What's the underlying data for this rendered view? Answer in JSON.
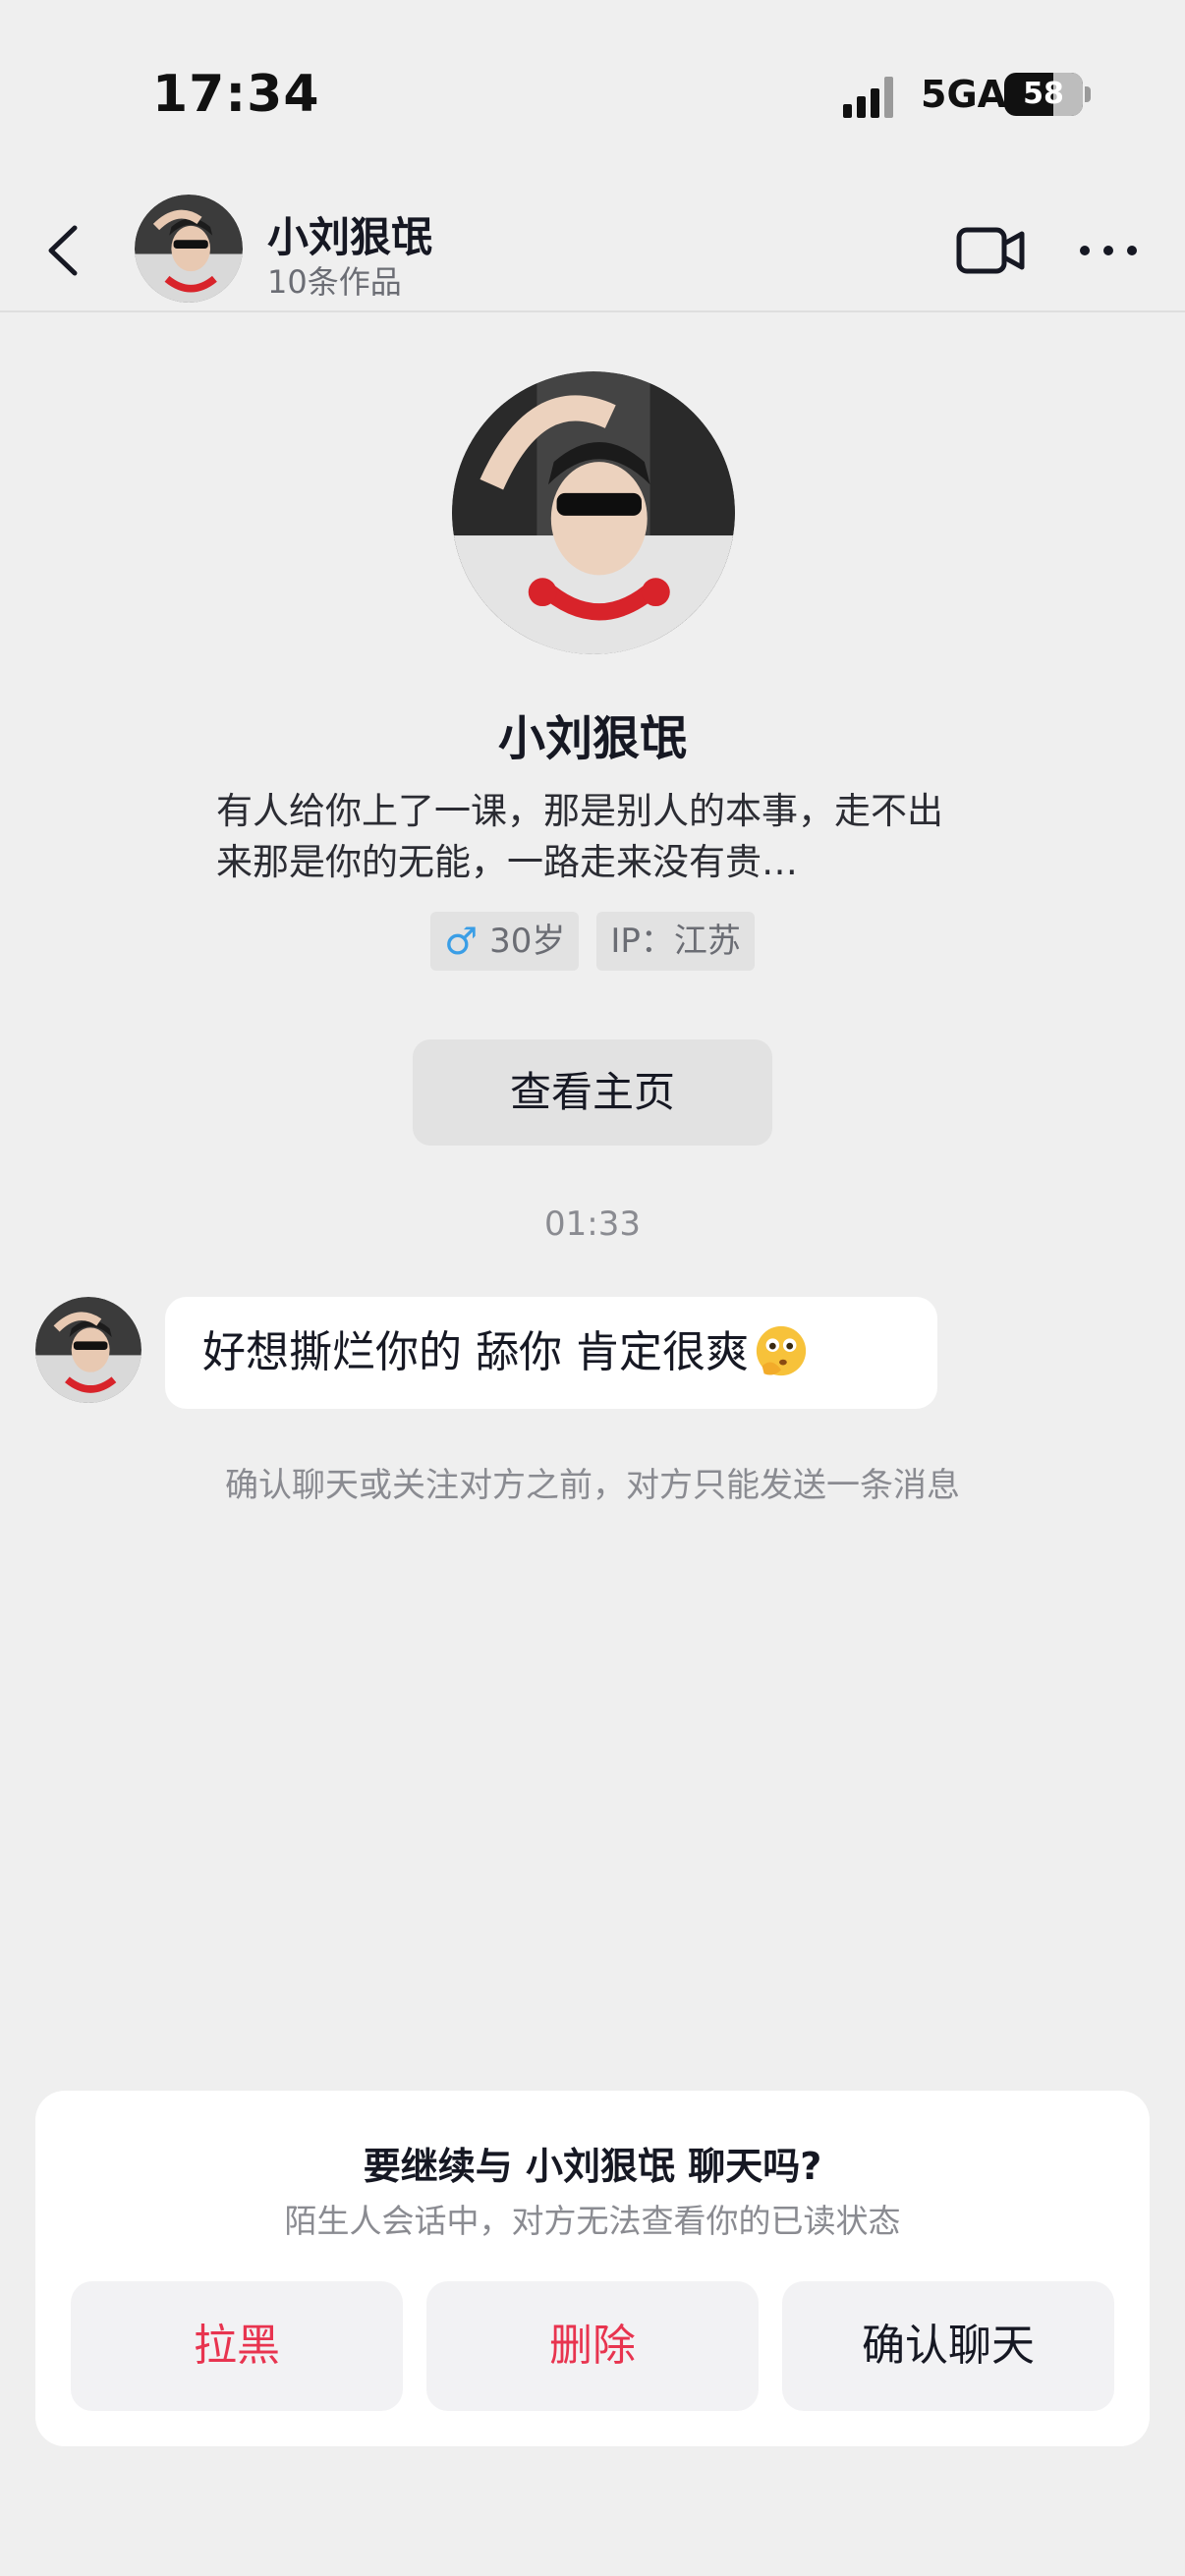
{
  "status_bar": {
    "time": "17:34",
    "network": "5GA",
    "battery": "58"
  },
  "header": {
    "name": "小刘狠氓",
    "subtitle": "10条作品",
    "icons": [
      "back-icon",
      "avatar",
      "video-call-icon",
      "more-icon"
    ]
  },
  "profile": {
    "name": "小刘狠氓",
    "bio": "有人给你上了一课，那是别人的本事，走不出来那是你的无能，一路走来没有贵…",
    "tags": {
      "gender_icon": "♂",
      "age": "30岁",
      "ip": "IP：江苏"
    },
    "home_button": "查看主页"
  },
  "chat": {
    "timestamp": "01:33",
    "messages": [
      {
        "text": "好想撕烂你的 舔你  肯定很爽",
        "emoji": "thinking-face"
      }
    ],
    "notice": "确认聊天或关注对方之前，对方只能发送一条消息"
  },
  "dialog": {
    "title": "要继续与 小刘狠氓 聊天吗?",
    "subtitle": "陌生人会话中，对方无法查看你的已读状态",
    "buttons": {
      "block": "拉黑",
      "delete": "删除",
      "confirm": "确认聊天"
    },
    "colors": {
      "danger": "#e8344f",
      "normal": "#161823"
    }
  }
}
